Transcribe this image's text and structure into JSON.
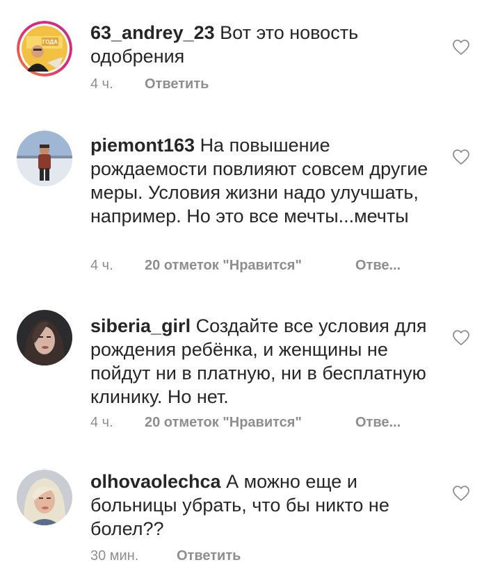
{
  "comments": [
    {
      "username": "63_andrey_23",
      "text": "Вот это новость одобрения",
      "time": "4 ч.",
      "likes": "",
      "reply": "Ответить",
      "avatar_label": "ГОДА"
    },
    {
      "username": "piemont163",
      "text": "На повышение рождаемости повлияют совсем другие меры. Условия  жизни надо улучшать, например. Но это все мечты...мечты",
      "time": "4 ч.",
      "likes": "20 отметок \"Нравится\"",
      "reply": "Отве..."
    },
    {
      "username": "siberia_girl",
      "text": "Создайте все условия для рождения ребёнка, и женщины не пойдут ни в платную, ни в бесплатную клинику. Но нет.",
      "time": "4 ч.",
      "likes": "20 отметок \"Нравится\"",
      "reply": "Отве..."
    },
    {
      "username": "olhovaolechca",
      "text": "А можно еще и больницы убрать, что бы никто не болел??",
      "time": "30 мин.",
      "likes": "",
      "reply": "Ответить"
    }
  ],
  "icons": {
    "like": "heart-outline-icon"
  },
  "colors": {
    "text": "#262626",
    "meta": "#8e8e8e",
    "story_ring_start": "#f58529",
    "story_ring_end": "#dd2a7b"
  }
}
